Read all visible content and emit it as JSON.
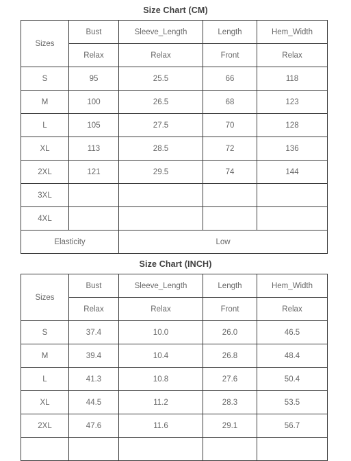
{
  "page": {
    "background_color": "#ffffff",
    "text_color": "#676767",
    "border_color": "#3a3a3a",
    "title_color": "#3f3f3f"
  },
  "charts": [
    {
      "id": "cm",
      "title": "Size Chart (CM)",
      "unit": "CM",
      "header": {
        "sizes_label": "Sizes",
        "measurements": [
          "Bust",
          "Sleeve_Length",
          "Length",
          "Hem_Width"
        ],
        "fit_types": [
          "Relax",
          "Relax",
          "Front",
          "Relax"
        ]
      },
      "rows": [
        {
          "size": "S",
          "values": [
            "95",
            "25.5",
            "66",
            "118"
          ]
        },
        {
          "size": "M",
          "values": [
            "100",
            "26.5",
            "68",
            "123"
          ]
        },
        {
          "size": "L",
          "values": [
            "105",
            "27.5",
            "70",
            "128"
          ]
        },
        {
          "size": "XL",
          "values": [
            "113",
            "28.5",
            "72",
            "136"
          ]
        },
        {
          "size": "2XL",
          "values": [
            "121",
            "29.5",
            "74",
            "144"
          ]
        },
        {
          "size": "3XL",
          "values": [
            "",
            "",
            "",
            ""
          ]
        },
        {
          "size": "4XL",
          "values": [
            "",
            "",
            "",
            ""
          ]
        }
      ],
      "footer": {
        "label": "Elasticity",
        "value": "Low"
      }
    },
    {
      "id": "inch",
      "title": "Size Chart (INCH)",
      "unit": "INCH",
      "header": {
        "sizes_label": "Sizes",
        "measurements": [
          "Bust",
          "Sleeve_Length",
          "Length",
          "Hem_Width"
        ],
        "fit_types": [
          "Relax",
          "Relax",
          "Front",
          "Relax"
        ]
      },
      "rows": [
        {
          "size": "S",
          "values": [
            "37.4",
            "10.0",
            "26.0",
            "46.5"
          ]
        },
        {
          "size": "M",
          "values": [
            "39.4",
            "10.4",
            "26.8",
            "48.4"
          ]
        },
        {
          "size": "L",
          "values": [
            "41.3",
            "10.8",
            "27.6",
            "50.4"
          ]
        },
        {
          "size": "XL",
          "values": [
            "44.5",
            "11.2",
            "28.3",
            "53.5"
          ]
        },
        {
          "size": "2XL",
          "values": [
            "47.6",
            "11.6",
            "29.1",
            "56.7"
          ]
        },
        {
          "size": "",
          "values": [
            "",
            "",
            "",
            ""
          ]
        }
      ],
      "footer": null
    }
  ]
}
